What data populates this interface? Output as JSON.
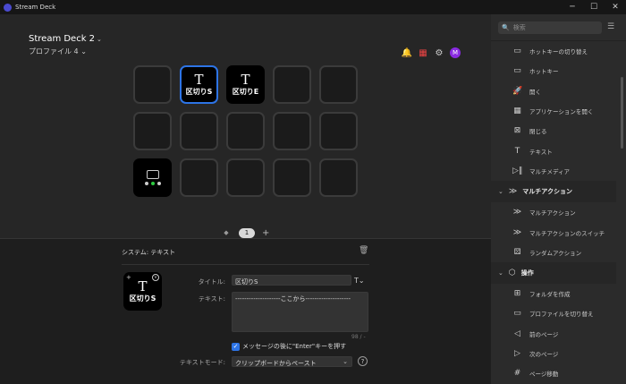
{
  "window": {
    "title": "Stream Deck",
    "min": "─",
    "max": "☐",
    "close": "✕"
  },
  "header": {
    "deck_name": "Stream Deck 2",
    "profile": "プロファイル 4"
  },
  "keys": [
    {
      "label": ""
    },
    {
      "label": "区切りS"
    },
    {
      "label": "区切りE"
    },
    {
      "label": ""
    },
    {
      "label": ""
    },
    {
      "label": ""
    },
    {
      "label": ""
    },
    {
      "label": ""
    },
    {
      "label": ""
    },
    {
      "label": ""
    },
    {
      "label": ""
    },
    {
      "label": ""
    },
    {
      "label": ""
    },
    {
      "label": ""
    },
    {
      "label": ""
    }
  ],
  "pager": {
    "page": "1",
    "prev": "◆",
    "add": "+"
  },
  "editor": {
    "system_label": "システム:   テキスト",
    "title_label": "タイトル:",
    "title_value": "区切りS",
    "text_label": "テキスト:",
    "text_value": "--------------------ここから--------------------",
    "counter": "98 / -",
    "checkbox_label": "メッセージの後に\"Enter\"キーを押す",
    "mode_label": "テキストモード:",
    "mode_value": "クリップボードからペースト",
    "help": "?",
    "preview_label": "区切りS",
    "t_glyph": "T"
  },
  "sidebar": {
    "search_placeholder": "検索",
    "items": [
      {
        "icon": "▭",
        "label": "ホットキーの切り替え"
      },
      {
        "icon": "▭",
        "label": "ホットキー"
      },
      {
        "icon": "🚀",
        "label": "開く"
      },
      {
        "icon": "▦",
        "label": "アプリケーションを開く"
      },
      {
        "icon": "⊠",
        "label": "閉じる"
      },
      {
        "icon": "T",
        "label": "テキスト"
      },
      {
        "icon": "▷‖",
        "label": "マルチメディア"
      }
    ],
    "cat_multi": "マルチアクション",
    "multi_items": [
      {
        "icon": "≫",
        "label": "マルチアクション"
      },
      {
        "icon": "≫",
        "label": "マルチアクションのスイッチ"
      },
      {
        "icon": "⚄",
        "label": "ランダムアクション"
      }
    ],
    "cat_ops": "操作",
    "ops_items": [
      {
        "icon": "⊞",
        "label": "フォルダを作成"
      },
      {
        "icon": "▭",
        "label": "プロファイルを切り替え"
      },
      {
        "icon": "◁",
        "label": "前のページ"
      },
      {
        "icon": "▷",
        "label": "次のページ"
      },
      {
        "icon": "#",
        "label": "ページ移動"
      }
    ]
  }
}
